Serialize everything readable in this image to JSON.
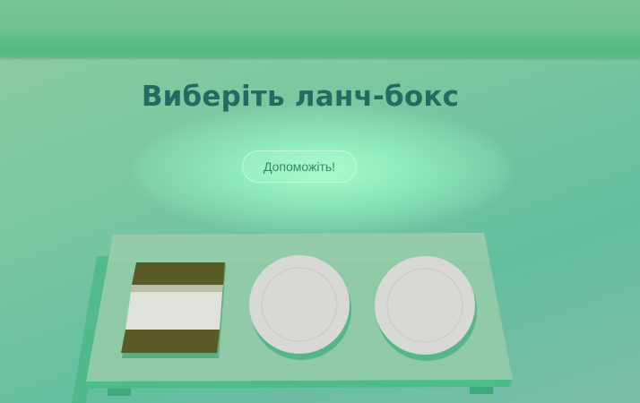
{
  "page": {
    "title": "Виберіть ланч-бокс",
    "help_button_label": "Допоможіть!"
  },
  "tray": {
    "items": [
      {
        "id": "sandwich-lunchbox",
        "icon": "sandwich-icon"
      },
      {
        "id": "plate-1",
        "icon": "empty-plate-icon"
      },
      {
        "id": "plate-2",
        "icon": "empty-plate-icon"
      }
    ]
  },
  "colors": {
    "background": "#7cc7a0",
    "title": "#236a61",
    "tray": "#8fc9a6",
    "help_text": "#2f8a62"
  }
}
